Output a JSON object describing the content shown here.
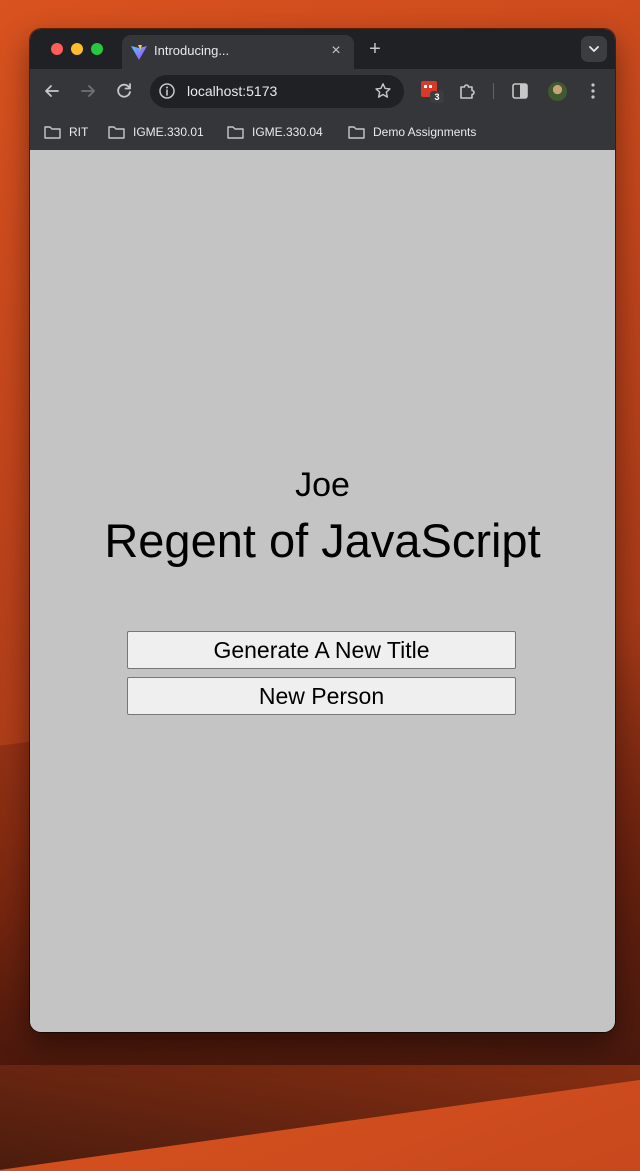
{
  "browser": {
    "tab": {
      "title": "Introducing...",
      "close_glyph": "×"
    },
    "new_tab_glyph": "+",
    "address_bar": {
      "url": "localhost:5173"
    },
    "extension_badge": "3",
    "bookmarks": [
      {
        "label": "RIT"
      },
      {
        "label": "IGME.330.01"
      },
      {
        "label": "IGME.330.04"
      },
      {
        "label": "Demo Assignments"
      }
    ],
    "icons": {
      "back": "arrow-left-icon",
      "forward": "arrow-right-icon",
      "reload": "reload-icon",
      "site_info": "info-icon",
      "bookmark_star": "star-icon",
      "extensions": "puzzle-icon",
      "side_panel": "side-panel-icon",
      "menu": "kebab-menu-icon",
      "tab_search": "chevron-down-icon",
      "bookmark_folder": "folder-icon"
    }
  },
  "page": {
    "name": "Joe",
    "title": "Regent of JavaScript",
    "buttons": {
      "generate_title": "Generate A New Title",
      "new_person": "New Person"
    },
    "background_color": "#c4c4c4"
  },
  "colors": {
    "chrome_dark": "#202124",
    "chrome_toolbar": "#35363a",
    "close_red": "#ff5f57",
    "minimize_yellow": "#febc2e",
    "zoom_green": "#28c840"
  }
}
